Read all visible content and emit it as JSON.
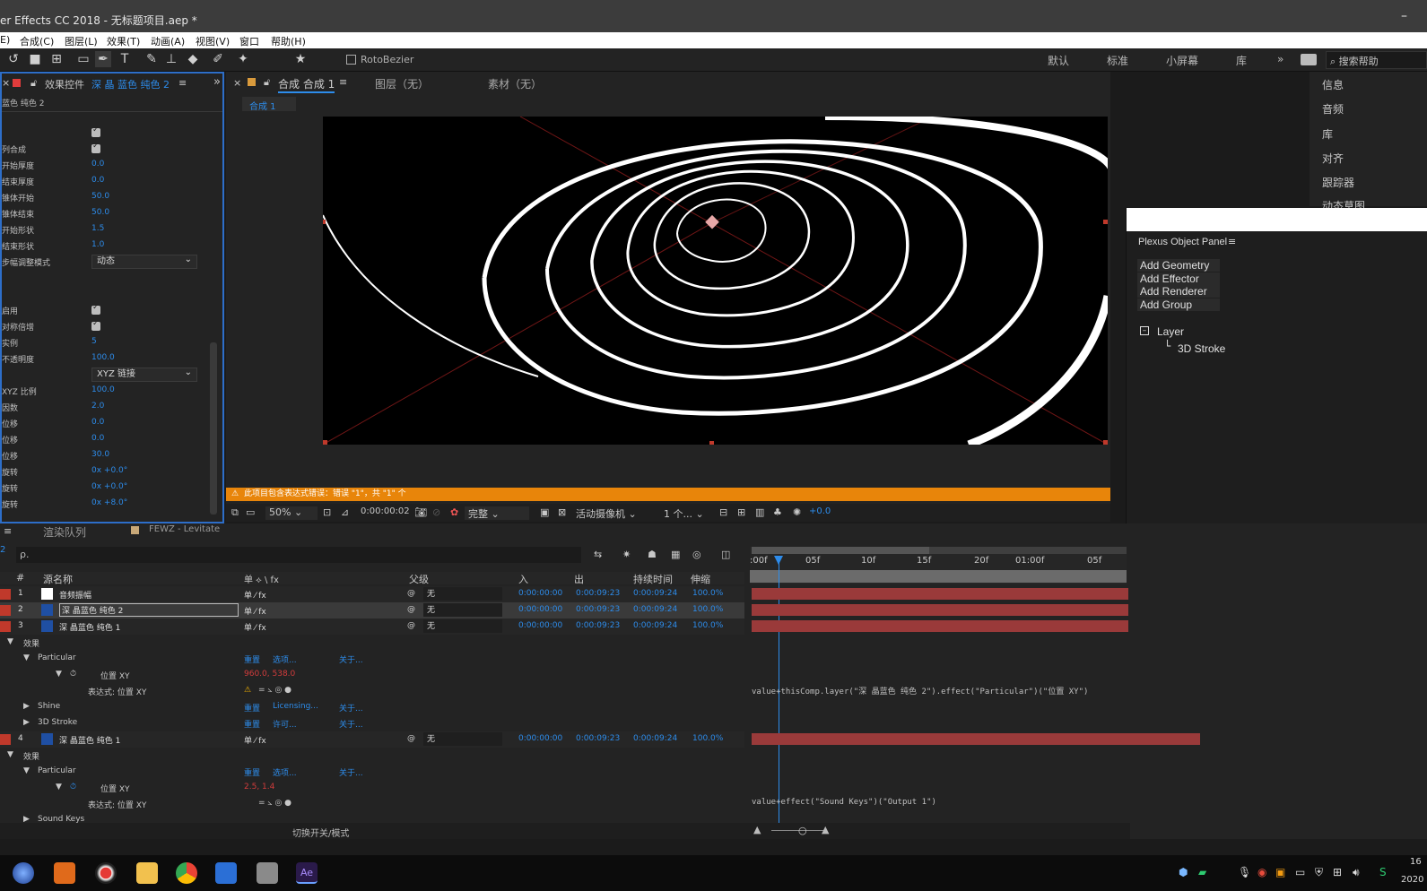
{
  "window": {
    "title": "er Effects CC 2018 - 无标题项目.aep *",
    "minimize": "–"
  },
  "menu": [
    "E)",
    "合成(C)",
    "图层(L)",
    "效果(T)",
    "动画(A)",
    "视图(V)",
    "窗口",
    "帮助(H)"
  ],
  "toolbar": {
    "rotobezier": "RotoBezier",
    "workspaces": [
      "默认",
      "标准",
      "小屏幕",
      "库"
    ],
    "more": "»",
    "search_placeholder": "搜索帮助"
  },
  "effects_panel": {
    "tab": "效果控件",
    "layer": "深 晶 蓝色 纯色 2",
    "subtitle": "蓝色 纯色 2",
    "rows": [
      {
        "label": "",
        "type": "check"
      },
      {
        "label": "列合成",
        "type": "check"
      },
      {
        "label": "开始厚度",
        "value": "0.0"
      },
      {
        "label": "结束厚度",
        "value": "0.0"
      },
      {
        "label": "锥体开始",
        "value": "50.0"
      },
      {
        "label": "锥体结束",
        "value": "50.0"
      },
      {
        "label": "开始形状",
        "value": "1.5"
      },
      {
        "label": "结束形状",
        "value": "1.0"
      },
      {
        "label": "步幅调整模式",
        "type": "dropdown",
        "value": "动态"
      },
      {
        "label": "",
        "value": ""
      },
      {
        "label": "",
        "value": ""
      },
      {
        "label": "启用",
        "type": "check"
      },
      {
        "label": "对称倍增",
        "type": "check"
      },
      {
        "label": "实例",
        "value": "5"
      },
      {
        "label": "不透明度",
        "value": "100.0"
      },
      {
        "label": "",
        "type": "dropdown",
        "value": "XYZ 链接"
      },
      {
        "label": "XYZ 比例",
        "value": "100.0"
      },
      {
        "label": "因数",
        "value": "2.0"
      },
      {
        "label": "位移",
        "value": "0.0"
      },
      {
        "label": "位移",
        "value": "0.0"
      },
      {
        "label": "位移",
        "value": "30.0"
      },
      {
        "label": "旋转",
        "value": "0x +0.0°"
      },
      {
        "label": "旋转",
        "value": "0x +0.0°"
      },
      {
        "label": "旋转",
        "value": "0x +8.0°"
      }
    ]
  },
  "comp_panel": {
    "tab": "合成 合成 1",
    "tab_layer": "图层（无）",
    "tab_footage": "素材（无）",
    "crumb": "合成 1",
    "warning": "此项目包含表达式错误：错误 \"1\"，共 \"1\" 个",
    "viewer_bar": {
      "zoom": "50%",
      "time": "0:00:00:02",
      "quality": "完整",
      "camera": "活动摄像机",
      "views": "1 个...",
      "exposure": "+0.0"
    }
  },
  "right_panel": {
    "items": [
      "信息",
      "音频",
      "库",
      "对齐",
      "跟踪器",
      "动态草图"
    ]
  },
  "plexus": {
    "title": "Plexus Object Panel",
    "buttons": [
      "Add Geometry",
      "Add Effector",
      "Add Renderer",
      "Add Group"
    ],
    "tree_root": "Layer",
    "tree_child": "3D Stroke"
  },
  "timeline": {
    "tabs": [
      "渲染队列",
      "FEWZ - Levitate"
    ],
    "frame": "2",
    "search_placeholder": "ρ.",
    "headers": {
      "num": "#",
      "name": "源名称",
      "switches": "单 ⟡ \\ fx",
      "parent": "父级",
      "in": "入",
      "out": "出",
      "duration": "持续时间",
      "stretch": "伸缩"
    },
    "ruler": [
      ":00f",
      "05f",
      "10f",
      "15f",
      "20f",
      "01:00f",
      "05f"
    ],
    "layers": [
      {
        "num": "1",
        "name": "音频振幅",
        "parent": "无",
        "in": "0:00:00:00",
        "out": "0:00:09:23",
        "dur": "0:00:09:24",
        "stretch": "100.0%"
      },
      {
        "num": "2",
        "name": "深 晶蓝色 纯色 2",
        "parent": "无",
        "in": "0:00:00:00",
        "out": "0:00:09:23",
        "dur": "0:00:09:24",
        "stretch": "100.0%"
      },
      {
        "num": "3",
        "name": "深 晶蓝色 纯色 1",
        "parent": "无",
        "in": "0:00:00:00",
        "out": "0:00:09:23",
        "dur": "0:00:09:24",
        "stretch": "100.0%"
      },
      {
        "num": "4",
        "name": "深 晶蓝色 纯色 1",
        "parent": "无",
        "in": "0:00:00:00",
        "out": "0:00:09:23",
        "dur": "0:00:09:24",
        "stretch": "100.0%"
      }
    ],
    "sub": {
      "effects": "效果",
      "particular": "Particular",
      "reset": "重置",
      "options": "选项...",
      "about": "关于...",
      "position": "位置 XY",
      "pos_value": "960.0, 538.0",
      "expression": "表达式: 位置 XY",
      "shine": "Shine",
      "licensing": "Licensing...",
      "stroke3d": "3D Stroke",
      "license": "许可...",
      "pos_value2": "2.5, 1.4",
      "soundkeys": "Sound Keys"
    },
    "expr1": "value+thisComp.layer(\"深 晶蓝色 纯色 2\").effect(\"Particular\")(\"位置 XY\")",
    "expr2": "value+effect(\"Sound Keys\")(\"Output 1\")",
    "footer": "切换开关/模式"
  },
  "taskbar": {
    "clock_top": "16",
    "clock_bottom": "2020"
  }
}
